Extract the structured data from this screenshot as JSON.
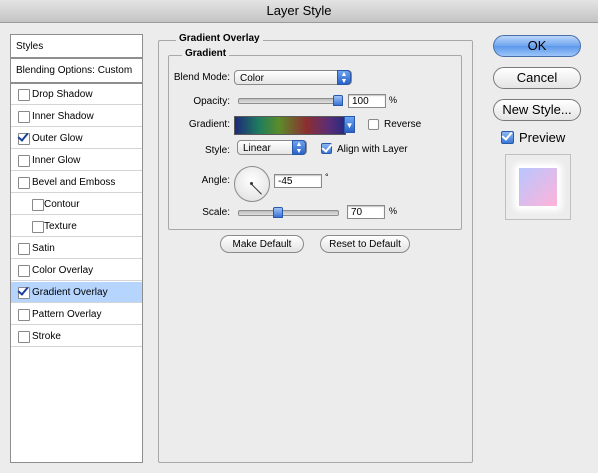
{
  "window": {
    "title": "Layer Style"
  },
  "styles_list": {
    "header": "Styles",
    "blending": "Blending Options: Custom",
    "items": [
      {
        "label": "Drop Shadow",
        "checked": false
      },
      {
        "label": "Inner Shadow",
        "checked": false
      },
      {
        "label": "Outer Glow",
        "checked": true
      },
      {
        "label": "Inner Glow",
        "checked": false
      },
      {
        "label": "Bevel and Emboss",
        "checked": false
      },
      {
        "label": "Contour",
        "checked": false
      },
      {
        "label": "Texture",
        "checked": false
      },
      {
        "label": "Satin",
        "checked": false
      },
      {
        "label": "Color Overlay",
        "checked": false
      },
      {
        "label": "Gradient Overlay",
        "checked": true,
        "selected": true
      },
      {
        "label": "Pattern Overlay",
        "checked": false
      },
      {
        "label": "Stroke",
        "checked": false
      }
    ]
  },
  "panel": {
    "title": "Gradient Overlay",
    "subtitle": "Gradient",
    "blend_mode_label": "Blend Mode:",
    "blend_mode_value": "Color",
    "opacity_label": "Opacity:",
    "opacity_value": "100",
    "opacity_unit": "%",
    "opacity_level": 1.0,
    "gradient_label": "Gradient:",
    "reverse_label": "Reverse",
    "reverse_checked": false,
    "style_label": "Style:",
    "style_value": "Linear",
    "align_label": "Align with Layer",
    "align_checked": true,
    "angle_label": "Angle:",
    "angle_value": "-45",
    "angle_unit": "°",
    "scale_label": "Scale:",
    "scale_value": "70",
    "scale_unit": "%",
    "make_default": "Make Default",
    "reset_default": "Reset to Default"
  },
  "buttons": {
    "ok": "OK",
    "cancel": "Cancel",
    "new_style": "New Style...",
    "preview_label": "Preview",
    "preview_checked": true
  },
  "colors": {
    "accent": "#3a74d8",
    "selected_row": "#b5d5ff"
  }
}
